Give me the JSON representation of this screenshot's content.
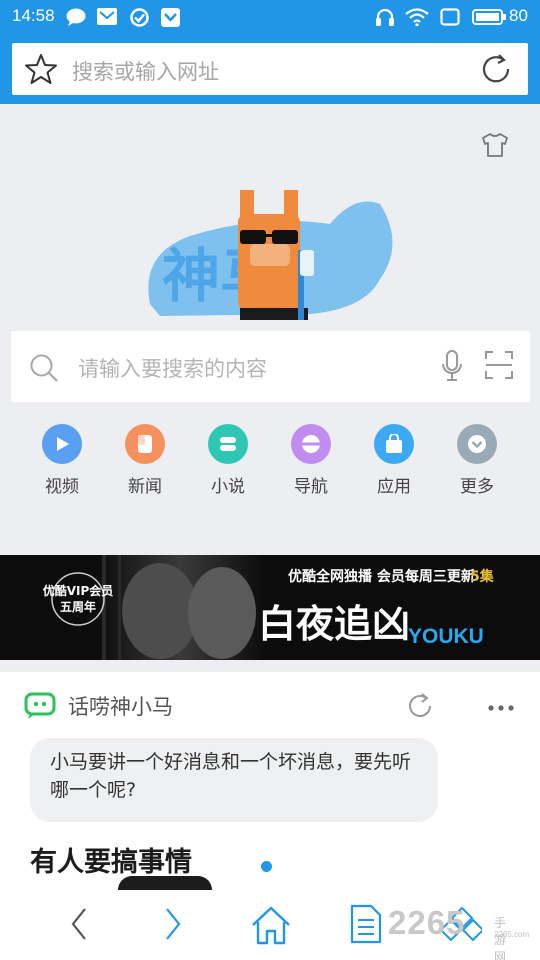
{
  "status_bar": {
    "time": "14:58",
    "battery": "80",
    "icons": [
      "chat-bubble-icon",
      "mail-icon",
      "check-circle-icon",
      "shield-icon",
      "headphones-icon",
      "wifi-icon",
      "screen-icon",
      "battery-icon"
    ]
  },
  "address_bar": {
    "placeholder": "搜索或输入网址",
    "icons": [
      "star-icon",
      "refresh-icon"
    ]
  },
  "logo": {
    "text": "神马"
  },
  "search": {
    "placeholder": "请输入要搜索的内容",
    "icons": [
      "search-icon",
      "microphone-icon",
      "scan-icon"
    ]
  },
  "shortcuts": [
    {
      "label": "视频",
      "icon": "play-icon",
      "color": "#5aa0f2"
    },
    {
      "label": "新闻",
      "icon": "news-icon",
      "color": "#f7905f"
    },
    {
      "label": "小说",
      "icon": "book-icon",
      "color": "#2fc6b4"
    },
    {
      "label": "导航",
      "icon": "compass-icon",
      "color": "#bf8cf2"
    },
    {
      "label": "应用",
      "icon": "bag-icon",
      "color": "#3ca9f5"
    },
    {
      "label": "更多",
      "icon": "more-icon",
      "color": "#9aa9b6"
    }
  ],
  "banner": {
    "badge_line1": "优酷VIP会员",
    "badge_line2": "五周年",
    "headline": "优酷全网独播 会员每周三更新",
    "highlight": "5集",
    "title": "白夜追凶",
    "brand": "YOUKU"
  },
  "card": {
    "title": "话唠神小马",
    "message": "小马要讲一个好消息和一个坏消息，要先听哪一个呢?",
    "headline": "有人要搞事情"
  },
  "bottom_nav": {
    "icons": [
      "back-icon",
      "forward-icon",
      "home-icon",
      "bookmarks-icon",
      "windows-icon"
    ]
  },
  "watermark": {
    "number": "2265",
    "label": "手游网",
    "url": "2265.com"
  },
  "colors": {
    "primary": "#2196e6",
    "background": "#eceef1",
    "chat_green": "#2ec05a"
  }
}
